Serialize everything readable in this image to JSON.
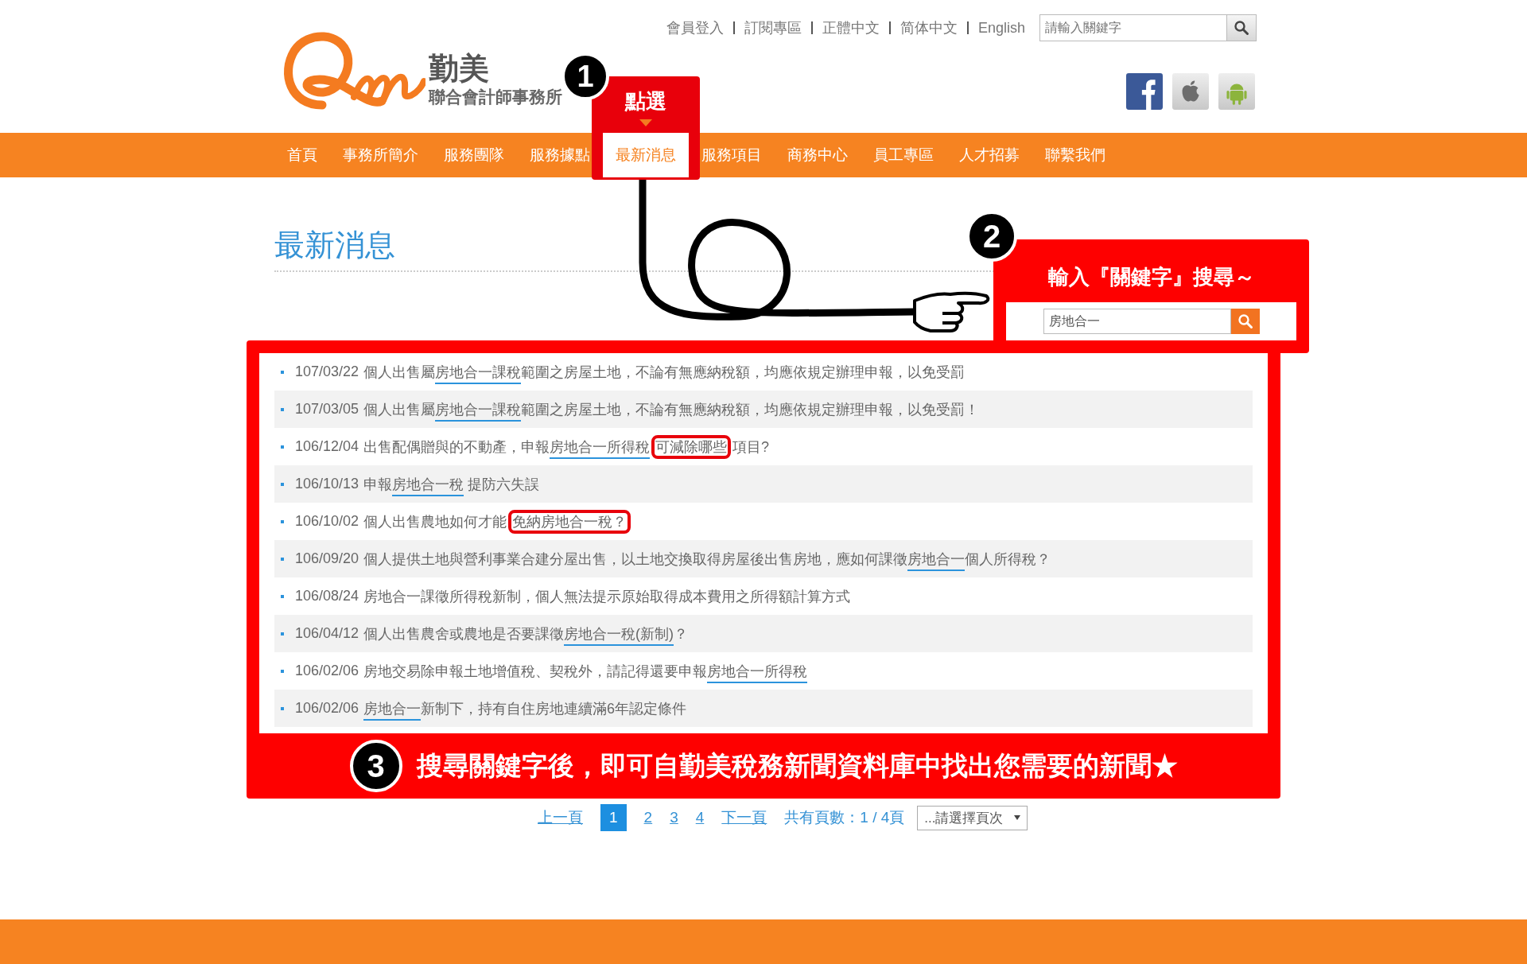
{
  "header": {
    "logo": {
      "name": "勤美",
      "subtitle": "聯合會計師事務所"
    },
    "top_links": [
      "會員登入",
      "訂閱專區",
      "正體中文",
      "简体中文",
      "English"
    ],
    "search": {
      "placeholder": "請輸入關鍵字"
    }
  },
  "nav": [
    {
      "label": "首頁",
      "selected": false
    },
    {
      "label": "事務所簡介",
      "selected": false
    },
    {
      "label": "服務團隊",
      "selected": false
    },
    {
      "label": "服務據點",
      "selected": false
    },
    {
      "label": "最新消息",
      "selected": true
    },
    {
      "label": "服務項目",
      "selected": false
    },
    {
      "label": "商務中心",
      "selected": false
    },
    {
      "label": "員工專區",
      "selected": false
    },
    {
      "label": "人才招募",
      "selected": false
    },
    {
      "label": "聯繫我們",
      "selected": false
    }
  ],
  "page_title": "最新消息",
  "news": [
    {
      "date": "107/03/22",
      "segments": [
        {
          "text": "個人出售屬",
          "underlined": false,
          "circled": false
        },
        {
          "text": "房地合一課稅",
          "underlined": true,
          "circled": false
        },
        {
          "text": "範圍之房屋土地，不論有無應納稅額，均應依規定辦理申報，以免受罰",
          "underlined": false,
          "circled": false
        }
      ]
    },
    {
      "date": "107/03/05",
      "segments": [
        {
          "text": "個人出售屬",
          "underlined": false,
          "circled": false
        },
        {
          "text": "房地合一課稅",
          "underlined": true,
          "circled": false
        },
        {
          "text": "範圍之房屋土地，不論有無應納稅額，均應依規定辦理申報，以免受罰！",
          "underlined": false,
          "circled": false
        }
      ]
    },
    {
      "date": "106/12/04",
      "segments": [
        {
          "text": "出售配偶贈與的不動產，申報",
          "underlined": false,
          "circled": false
        },
        {
          "text": "房地合一所得稅",
          "underlined": true,
          "circled": false
        },
        {
          "text": "可減除哪些",
          "underlined": false,
          "circled": true
        },
        {
          "text": "項目?",
          "underlined": false,
          "circled": false
        }
      ]
    },
    {
      "date": "106/10/13",
      "segments": [
        {
          "text": "申報",
          "underlined": false,
          "circled": false
        },
        {
          "text": "房地合一稅",
          "underlined": true,
          "circled": false
        },
        {
          "text": " 提防六失誤",
          "underlined": false,
          "circled": false
        }
      ]
    },
    {
      "date": "106/10/02",
      "segments": [
        {
          "text": "個人出售農地如何才能",
          "underlined": false,
          "circled": false
        },
        {
          "text": "免納房地合一稅？",
          "underlined": false,
          "circled": true
        }
      ]
    },
    {
      "date": "106/09/20",
      "segments": [
        {
          "text": "個人提供土地與營利事業合建分屋出售，以土地交換取得房屋後出售房地，應如何課徵",
          "underlined": false,
          "circled": false
        },
        {
          "text": "房地合一",
          "underlined": true,
          "circled": false
        },
        {
          "text": "個人所得稅？",
          "underlined": false,
          "circled": false
        }
      ]
    },
    {
      "date": "106/08/24",
      "segments": [
        {
          "text": "房地合一課徵所得稅新制，個人無法提示原始取得成本費用之所得額計算方式",
          "underlined": false,
          "circled": false
        }
      ]
    },
    {
      "date": "106/04/12",
      "segments": [
        {
          "text": "個人出售農舍或農地是否要課徵",
          "underlined": false,
          "circled": false
        },
        {
          "text": "房地合一稅(新制)",
          "underlined": true,
          "circled": false
        },
        {
          "text": "？",
          "underlined": false,
          "circled": false
        }
      ]
    },
    {
      "date": "106/02/06",
      "segments": [
        {
          "text": "房地交易除申報土地增值稅、契稅外，請記得還要申報",
          "underlined": false,
          "circled": false
        },
        {
          "text": "房地合一所得稅",
          "underlined": true,
          "circled": false
        }
      ]
    },
    {
      "date": "106/02/06",
      "segments": [
        {
          "text": "房地合一",
          "underlined": true,
          "circled": false
        },
        {
          "text": "新制下，持有自住房地連續滿6年認定條件",
          "underlined": false,
          "circled": false
        }
      ]
    }
  ],
  "pagination": {
    "prev": "上一頁",
    "pages": [
      {
        "label": "1",
        "selected": true
      },
      {
        "label": "2",
        "selected": false
      },
      {
        "label": "3",
        "selected": false
      },
      {
        "label": "4",
        "selected": false
      }
    ],
    "next": "下一頁",
    "summary": "共有頁數：1 / 4頁",
    "select": "...請選擇頁次"
  },
  "annotations": {
    "step1": {
      "number": "1",
      "label": "點選"
    },
    "step2": {
      "number": "2",
      "title": "輸入『關鍵字』搜尋～",
      "search_value": "房地合一"
    },
    "step3": {
      "number": "3",
      "text": "搜尋關鍵字後，即可自勤美稅務新聞資料庫中找出您需要的新聞★"
    }
  }
}
